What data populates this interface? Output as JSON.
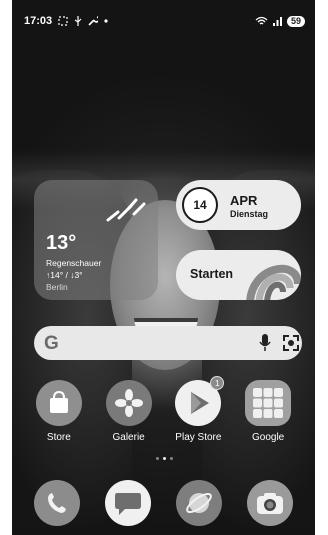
{
  "status_bar": {
    "time": "17:03",
    "left_icons": [
      "screenshot-icon",
      "usb-icon",
      "wrench-icon",
      "dot-icon"
    ],
    "right_icons": [
      "wifi-icon",
      "signal-icon"
    ],
    "battery": "59"
  },
  "weather": {
    "temperature": "13°",
    "condition": "Regenschauer",
    "range": "↑14° / ↓3°",
    "city": "Berlin",
    "icon": "rain-icon"
  },
  "date_widget": {
    "day_number": "14",
    "month": "APR",
    "weekday": "Dienstag"
  },
  "starten_widget": {
    "label": "Starten",
    "icon": "rainbow-icon"
  },
  "search": {
    "logo": "G",
    "icons": [
      "mic-icon",
      "lens-icon"
    ]
  },
  "apps": [
    {
      "label": "Store",
      "icon": "store-bag-icon"
    },
    {
      "label": "Galerie",
      "icon": "flower-icon"
    },
    {
      "label": "Play Store",
      "icon": "play-icon",
      "badge": "1"
    },
    {
      "label": "Google",
      "icon": "google-folder-icon"
    }
  ],
  "dock": [
    {
      "icon": "phone-icon"
    },
    {
      "icon": "messages-icon"
    },
    {
      "icon": "browser-icon"
    },
    {
      "icon": "camera-icon"
    }
  ],
  "colors": {
    "widget_light": "#ececec",
    "widget_weather": "#828282"
  }
}
